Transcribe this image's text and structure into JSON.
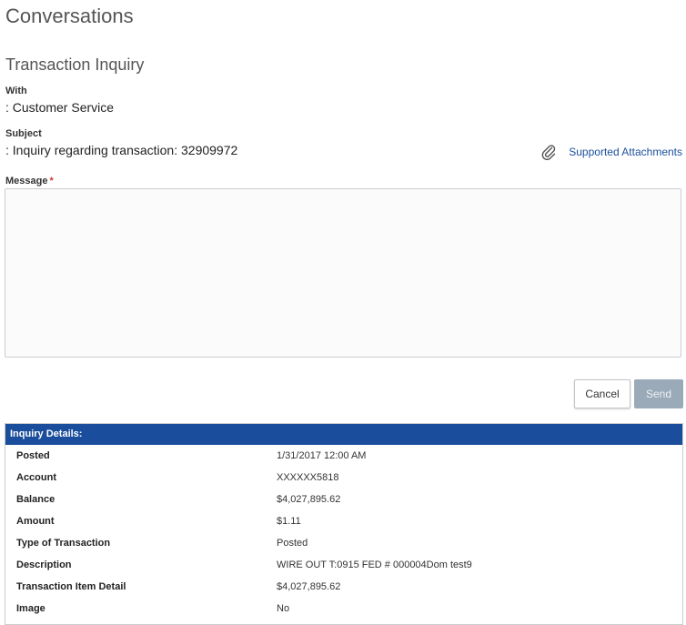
{
  "page": {
    "title": "Conversations"
  },
  "form": {
    "title": "Transaction Inquiry",
    "with_label": "With",
    "with_value": ": Customer Service",
    "subject_label": "Subject",
    "subject_value": ": Inquiry regarding transaction: 32909972",
    "attachments_link": "Supported Attachments",
    "attachments_icon": "paperclip-icon",
    "message_label": "Message",
    "message_required_mark": "*",
    "message_value": "",
    "cancel_label": "Cancel",
    "send_label": "Send"
  },
  "details": {
    "header": "Inquiry Details:",
    "rows": [
      {
        "label": "Posted",
        "value": "1/31/2017 12:00 AM"
      },
      {
        "label": "Account",
        "value": "XXXXXX5818"
      },
      {
        "label": "Balance",
        "value": "$4,027,895.62"
      },
      {
        "label": "Amount",
        "value": "$1.11"
      },
      {
        "label": "Type of Transaction",
        "value": "Posted"
      },
      {
        "label": "Description",
        "value": "WIRE OUT T:0915 FED # 000004Dom test9"
      },
      {
        "label": "Transaction Item Detail",
        "value": "$4,027,895.62"
      },
      {
        "label": "Image",
        "value": "No"
      }
    ]
  },
  "colors": {
    "header_blue": "#1a4e9c",
    "link_blue": "#1b4f9e",
    "send_disabled": "#9aaab8",
    "required_red": "#d0392b"
  }
}
